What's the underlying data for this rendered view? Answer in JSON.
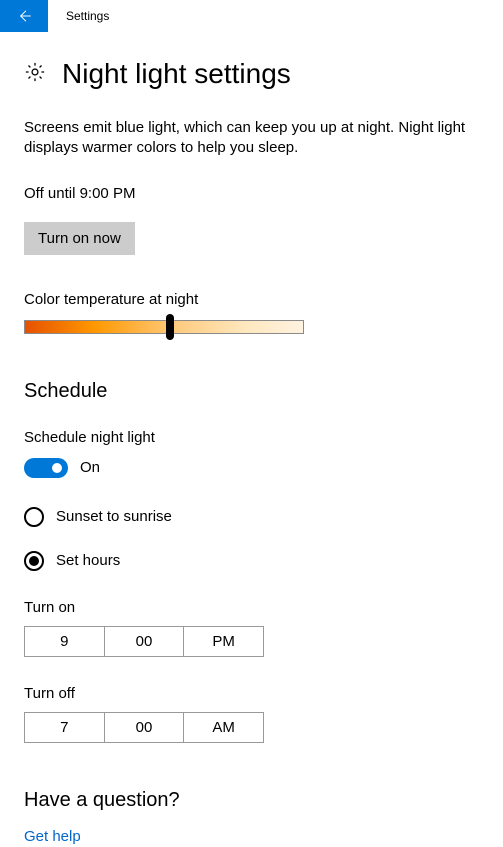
{
  "titlebar": {
    "app_name": "Settings"
  },
  "header": {
    "title": "Night light settings"
  },
  "description": "Screens emit blue light, which can keep you up at night. Night light displays warmer colors to help you sleep.",
  "status": "Off until 9:00 PM",
  "turn_on_button": "Turn on now",
  "slider_label": "Color temperature at night",
  "schedule": {
    "heading": "Schedule",
    "toggle_label": "Schedule night light",
    "toggle_state": "On",
    "option_sunset": "Sunset to sunrise",
    "option_set_hours": "Set hours",
    "turn_on_label": "Turn on",
    "turn_on": {
      "hour": "9",
      "minute": "00",
      "ampm": "PM"
    },
    "turn_off_label": "Turn off",
    "turn_off": {
      "hour": "7",
      "minute": "00",
      "ampm": "AM"
    }
  },
  "help": {
    "heading": "Have a question?",
    "link": "Get help"
  }
}
